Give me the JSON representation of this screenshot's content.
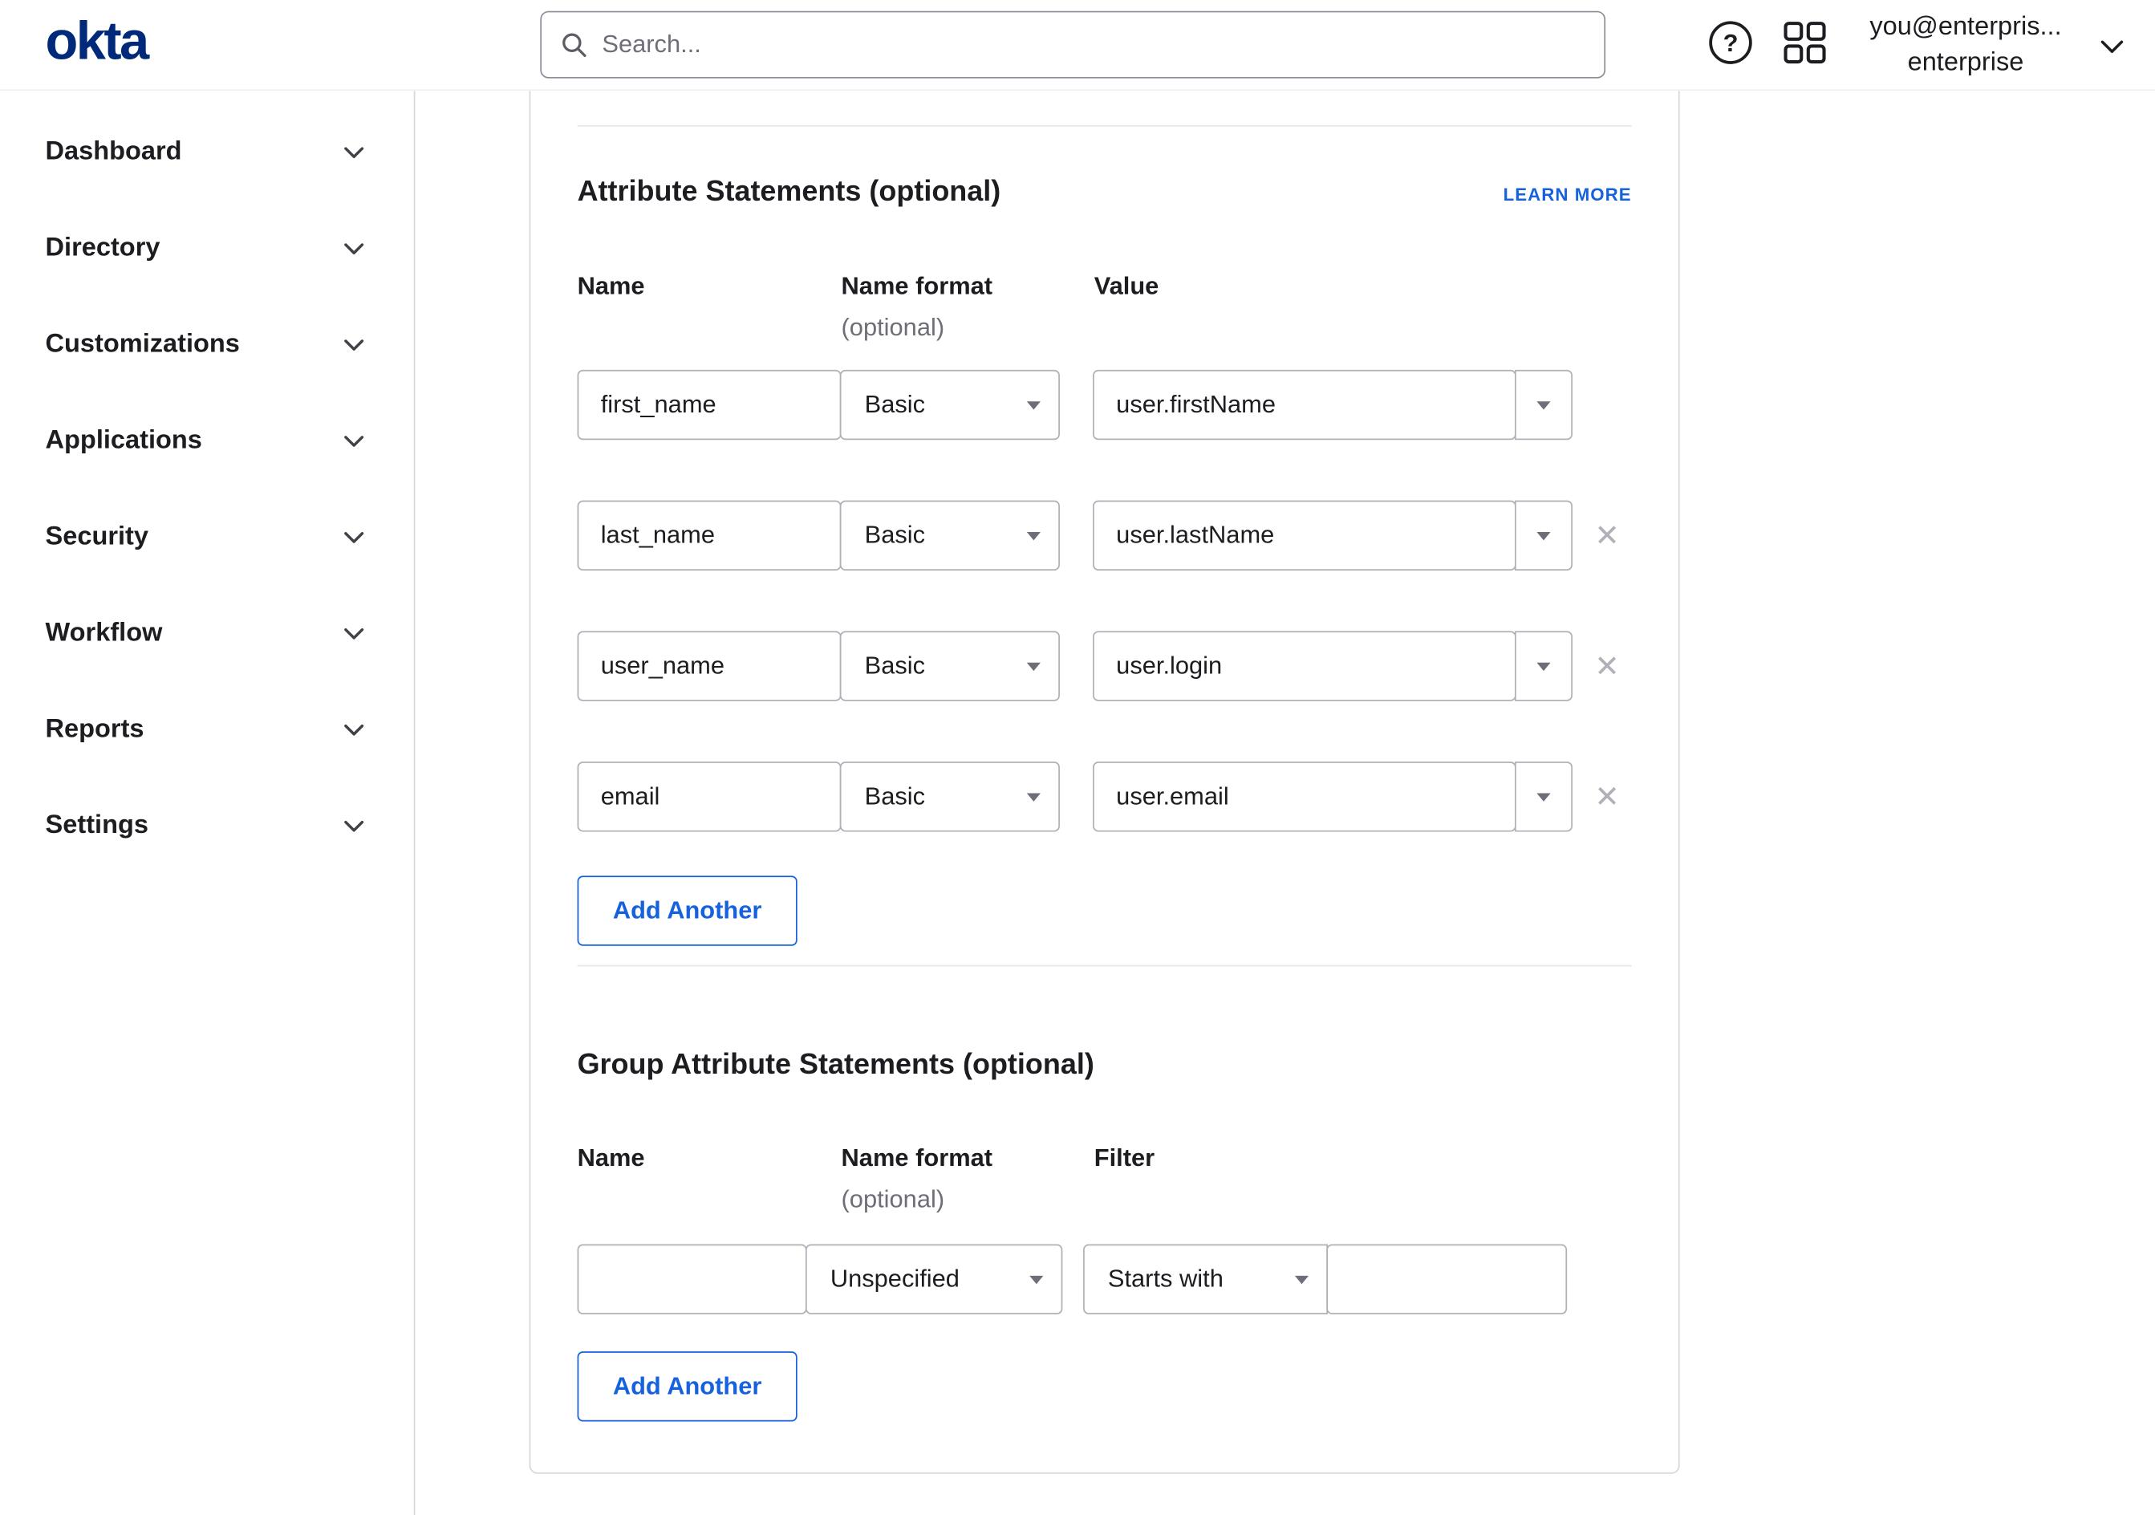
{
  "brand": {
    "logo_text": "okta",
    "logo_color": "#00297a"
  },
  "header": {
    "search_placeholder": "Search...",
    "user": {
      "email": "you@enterpris...",
      "org": "enterprise"
    }
  },
  "sidebar": {
    "items": [
      {
        "label": "Dashboard"
      },
      {
        "label": "Directory"
      },
      {
        "label": "Customizations"
      },
      {
        "label": "Applications"
      },
      {
        "label": "Security"
      },
      {
        "label": "Workflow"
      },
      {
        "label": "Reports"
      },
      {
        "label": "Settings"
      }
    ]
  },
  "attribute_statements": {
    "title": "Attribute Statements (optional)",
    "learn_more": "LEARN MORE",
    "columns": {
      "name": "Name",
      "name_format": "Name format",
      "name_format_note": "(optional)",
      "value": "Value"
    },
    "rows": [
      {
        "name": "first_name",
        "format": "Basic",
        "value": "user.firstName"
      },
      {
        "name": "last_name",
        "format": "Basic",
        "value": "user.lastName"
      },
      {
        "name": "user_name",
        "format": "Basic",
        "value": "user.login"
      },
      {
        "name": "email",
        "format": "Basic",
        "value": "user.email"
      }
    ],
    "remove_glyph": "✕",
    "add_button": "Add Another"
  },
  "group_attribute_statements": {
    "title": "Group Attribute Statements (optional)",
    "columns": {
      "name": "Name",
      "name_format": "Name format",
      "name_format_note": "(optional)",
      "filter": "Filter"
    },
    "rows": [
      {
        "name": "",
        "format": "Unspecified",
        "filter_type": "Starts with",
        "filter_value": ""
      }
    ],
    "add_button": "Add Another"
  },
  "colors": {
    "brand_navy": "#00297a",
    "link_blue": "#1662dd",
    "border_gray": "#d7d7dc",
    "input_border": "#b0b0b8",
    "muted_text": "#6e6e78"
  }
}
